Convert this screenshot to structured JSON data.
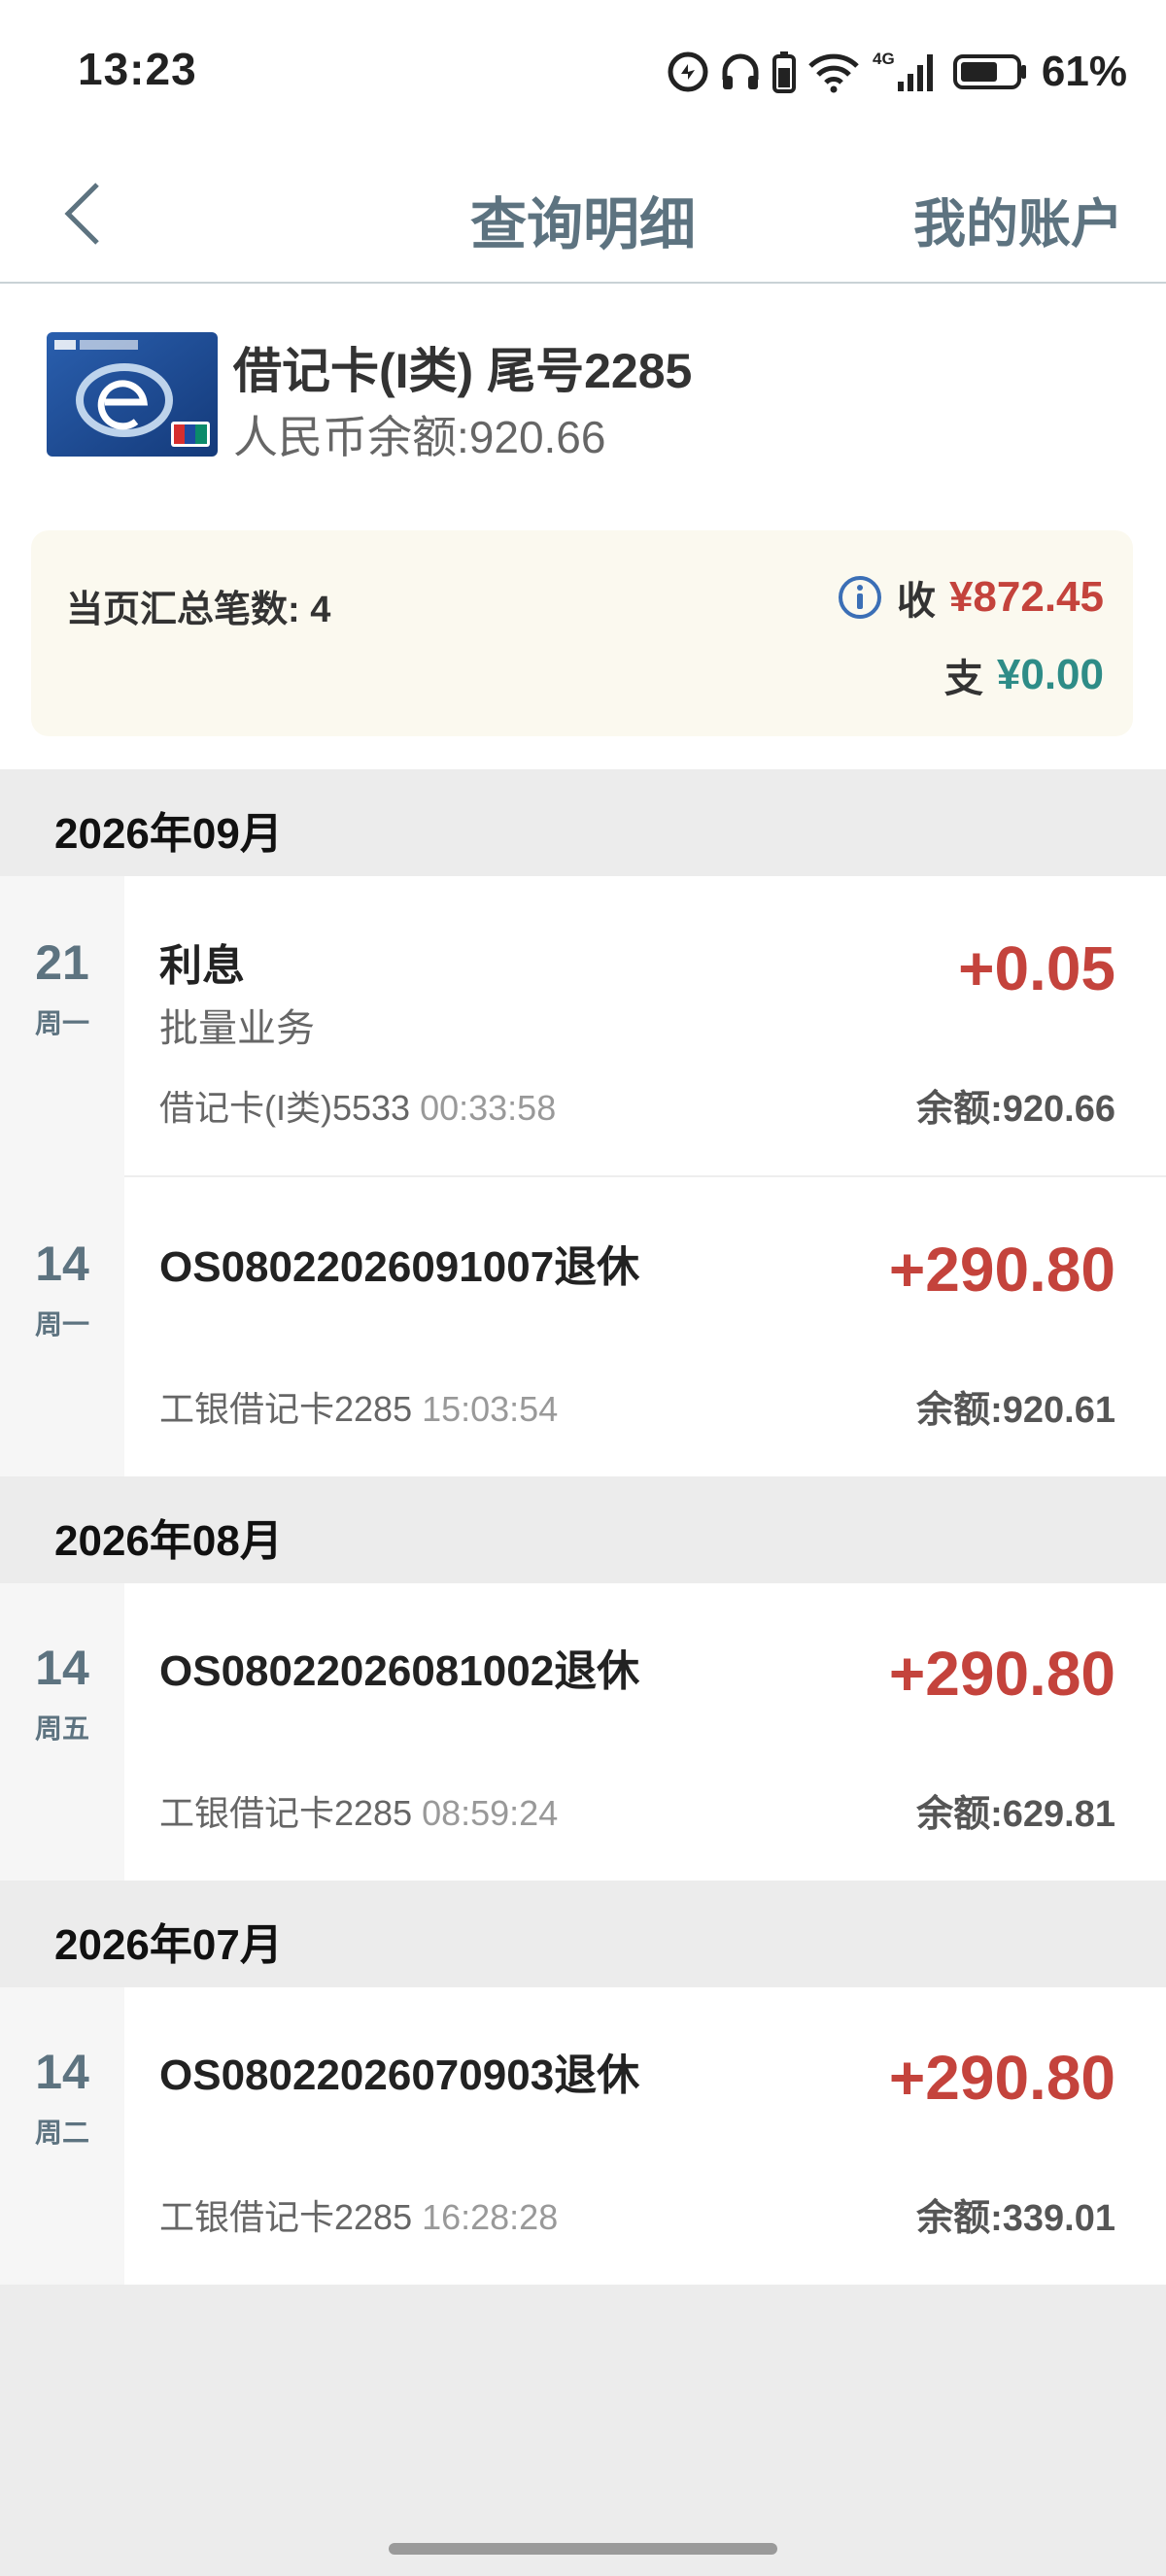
{
  "status": {
    "time": "13:23",
    "battery": "61%",
    "network": "4G"
  },
  "nav": {
    "back_icon": "chevron-left-icon",
    "title": "查询明细",
    "right": "我的账户"
  },
  "account": {
    "title": "借记卡(I类) 尾号2285",
    "balance": "人民币余额:920.66"
  },
  "summary": {
    "count": "当页汇总笔数: 4",
    "in_label": "收",
    "in_value": "¥872.45",
    "out_label": "支",
    "out_value": "¥0.00"
  },
  "groups": [
    {
      "month": "2026年09月",
      "items": [
        {
          "day": "21",
          "weekday": "周一",
          "title": "利息",
          "sub": "批量业务",
          "amount": "+0.05",
          "card": "借记卡(I类)5533",
          "time": "00:33:58",
          "balance": "余额:920.66"
        },
        {
          "day": "14",
          "weekday": "周一",
          "title": "OS08022026091007退休",
          "sub": "",
          "amount": "+290.80",
          "card": "工银借记卡2285",
          "time": "15:03:54",
          "balance": "余额:920.61"
        }
      ]
    },
    {
      "month": "2026年08月",
      "items": [
        {
          "day": "14",
          "weekday": "周五",
          "title": "OS08022026081002退休",
          "sub": "",
          "amount": "+290.80",
          "card": "工银借记卡2285",
          "time": "08:59:24",
          "balance": "余额:629.81"
        }
      ]
    },
    {
      "month": "2026年07月",
      "items": [
        {
          "day": "14",
          "weekday": "周二",
          "title": "OS08022026070903退休",
          "sub": "",
          "amount": "+290.80",
          "card": "工银借记卡2285",
          "time": "16:28:28",
          "balance": "余额:339.01"
        }
      ]
    }
  ],
  "colors": {
    "income": "#c4433c",
    "expense": "#2e8c87",
    "accent": "#5d7380"
  }
}
